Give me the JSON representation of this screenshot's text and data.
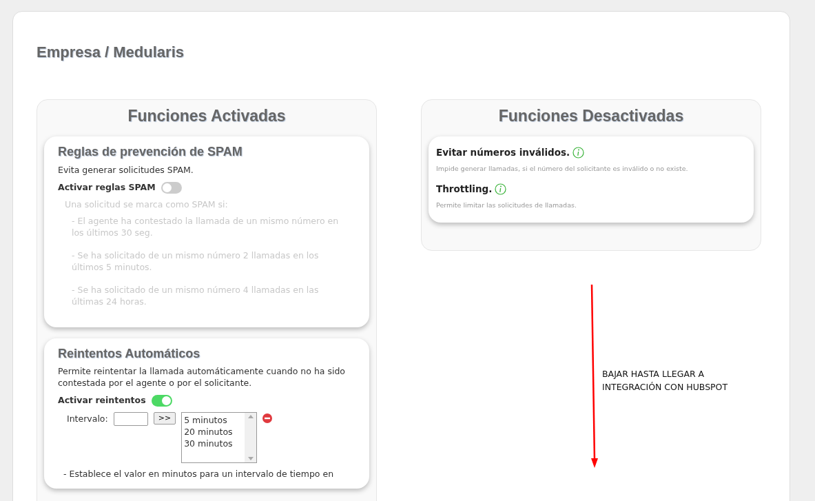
{
  "title": "Empresa / Medularis",
  "enabled": {
    "heading": "Funciones Activadas",
    "features": [
      {
        "kind": "spam",
        "title": "Reglas de prevención de SPAM",
        "description": "Evita generar solicitudes SPAM.",
        "toggle": {
          "label": "Activar reglas SPAM",
          "on": false
        },
        "rules_intro": "Una solicitud se marca como SPAM si:",
        "rules": [
          "- El agente ha contestado la llamada de un mismo número en los últimos 30 seg.",
          "- Se ha solicitado de un mismo número 2 llamadas en los últimos 5 minutos.",
          "- Se ha solicitado de un mismo número 4 llamadas en las últimas 24 horas."
        ]
      },
      {
        "kind": "retries",
        "title": "Reintentos Automáticos",
        "description": "Permite reintentar la llamada automáticamente cuando no ha sido contestada por el agente o por el solicitante.",
        "toggle": {
          "label": "Activar reintentos",
          "on": true
        },
        "interval": {
          "label": "Intervalo:",
          "button": ">>",
          "options": [
            "5 minutos",
            "20 minutos",
            "30 minutos"
          ]
        },
        "note": "- Establece el valor en minutos para un intervalo de tiempo en"
      }
    ]
  },
  "disabled": {
    "heading": "Funciones Desactivadas",
    "features": [
      {
        "title": "Evitar números inválidos.",
        "description": "Impide generar llamadas, si el número del solicitante es inválido o no existe."
      },
      {
        "title": "Throttling.",
        "description": "Permite limitar las solicitudes de llamadas."
      }
    ]
  },
  "annotation": {
    "text": "BAJAR HASTA LLEGAR A INTEGRACIÓN CON HUBSPOT"
  }
}
